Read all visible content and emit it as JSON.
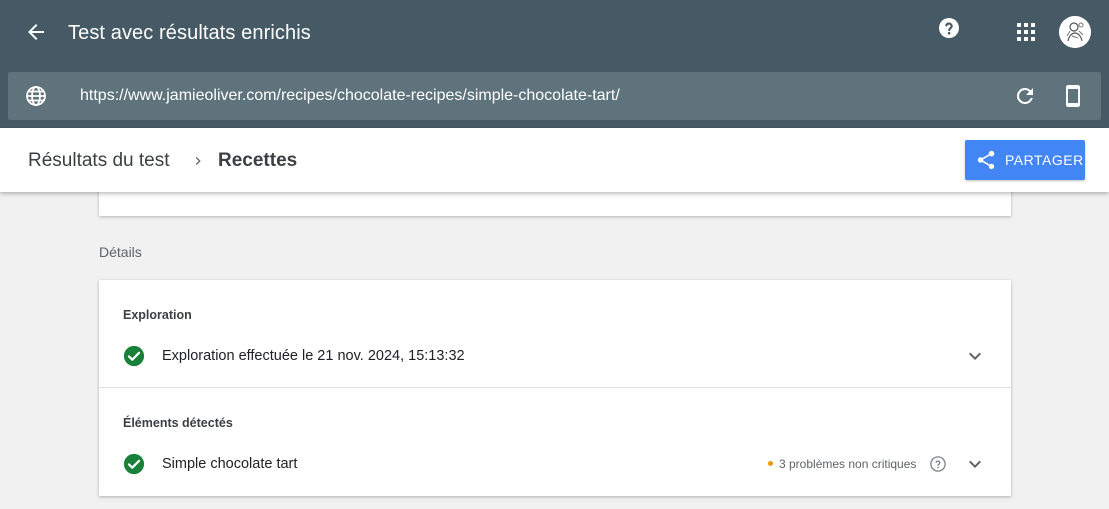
{
  "header": {
    "title": "Test avec résultats enrichis",
    "back_icon": "arrow-back-icon",
    "help_icon": "help-icon",
    "apps_icon": "apps-grid-icon",
    "avatar_icon": "user-avatar"
  },
  "urlbar": {
    "globe_icon": "globe-icon",
    "url": "https://www.jamieoliver.com/recipes/chocolate-recipes/simple-chocolate-tart/",
    "refresh_icon": "refresh-icon",
    "device_icon": "smartphone-icon"
  },
  "breadcrumb": {
    "root": "Résultats du test",
    "current": "Recettes",
    "separator_icon": "chevron-right-icon"
  },
  "share": {
    "label": "PARTAGER",
    "icon": "share-icon"
  },
  "details": {
    "section_label": "Détails",
    "crawl": {
      "title": "Exploration",
      "status_text": "Exploration effectuée le 21 nov. 2024, 15:13:32",
      "status_icon": "check-circle-icon"
    },
    "detected": {
      "title": "Éléments détectés",
      "item_name": "Simple chocolate tart",
      "item_status_icon": "check-circle-icon",
      "issues_text": "3 problèmes non critiques",
      "issues_help_icon": "help-outline-icon"
    }
  },
  "colors": {
    "header_bg": "#455a64",
    "urlbar_bg": "#5f737d",
    "accent_blue": "#4285f4",
    "success_green": "#188038",
    "warning_orange": "#f29900",
    "page_bg": "#f1f1f1"
  }
}
